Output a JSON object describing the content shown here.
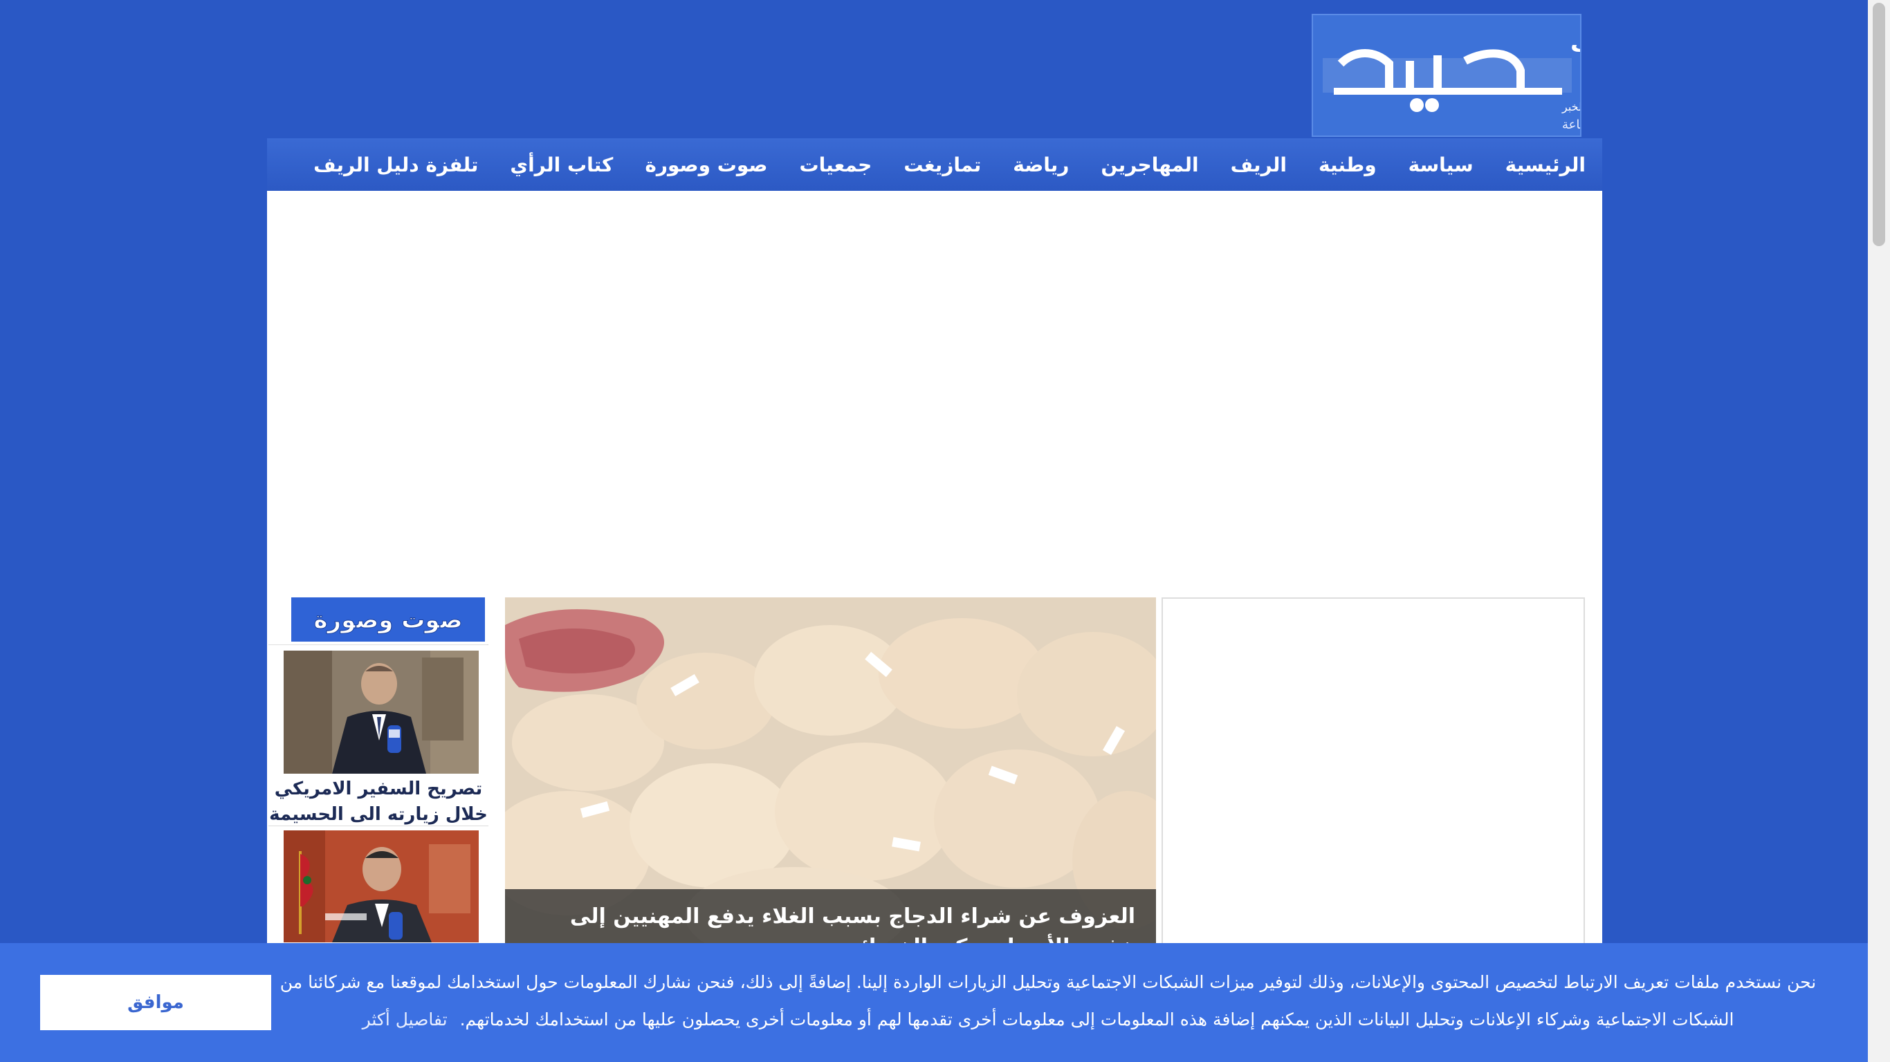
{
  "header": {
    "logo": {
      "title": "شبكة دليل الريف",
      "tagline": "الموضوعية في نقل الخبر",
      "subtagline": "جريدة الكترونية تتجدد على مدار الساعة"
    }
  },
  "nav": {
    "items": [
      {
        "label": "الرئيسية"
      },
      {
        "label": "سياسة"
      },
      {
        "label": "وطنية"
      },
      {
        "label": "الريف"
      },
      {
        "label": "المهاجرين"
      },
      {
        "label": "رياضة"
      },
      {
        "label": "تمازيغت"
      },
      {
        "label": "جمعيات"
      },
      {
        "label": "صوت وصورة"
      },
      {
        "label": "كتاب الرأي"
      },
      {
        "label": "تلفزة دليل الريف"
      }
    ]
  },
  "sidebar": {
    "heading": "صوت وصورة",
    "videos": [
      {
        "title": "تصريح السفير الامريكي خلال زيارته الى الحسيمة"
      },
      {
        "title": ""
      }
    ]
  },
  "featured": {
    "caption": "العزوف عن شراء الدجاج بسبب الغلاء يدفع المهنيين إلى خفض الأسعار وتكبد الخسائر"
  },
  "cookie_banner": {
    "text": "نحن نستخدم ملفات تعريف الارتباط لتخصيص المحتوى والإعلانات، وذلك لتوفير ميزات الشبكات الاجتماعية وتحليل الزيارات الواردة إلينا. إضافةً إلى ذلك، فنحن نشارك المعلومات حول استخدامك لموقعنا مع شركائنا من الشبكات الاجتماعية وشركاء الإعلانات وتحليل البيانات الذين يمكنهم إضافة هذه المعلومات إلى معلومات أخرى تقدمها لهم أو معلومات أخرى يحصلون عليها من استخدامك لخدماتهم.",
    "details_link": "تفاصيل أكثر",
    "accept_label": "موافق"
  },
  "colors": {
    "page_background": "#2a58c5",
    "nav_background": "#3a6ad4",
    "cookie_background": "#3c70e2",
    "accent_text": "#1c2a55"
  }
}
